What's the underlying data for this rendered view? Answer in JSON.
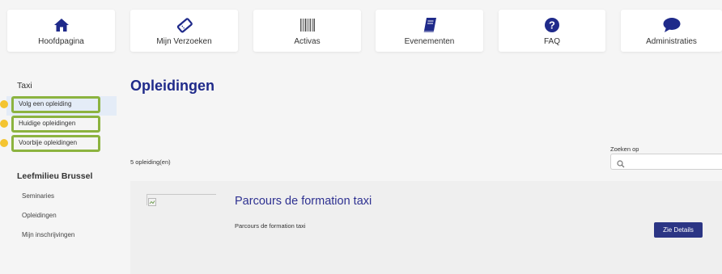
{
  "nav": {
    "items": [
      {
        "label": "Hoofdpagina",
        "icon": "home-icon"
      },
      {
        "label": "Mijn Verzoeken",
        "icon": "ticket-icon"
      },
      {
        "label": "Activas",
        "icon": "barcode-icon"
      },
      {
        "label": "Evenementen",
        "icon": "book-icon"
      },
      {
        "label": "FAQ",
        "icon": "question-circle-icon"
      },
      {
        "label": "Administraties",
        "icon": "speech-bubble-icon"
      }
    ],
    "accent_color": "#1f2a8a"
  },
  "sidebar": {
    "section1_title": "Taxi",
    "section1_items": [
      {
        "label": "Volg een opleiding"
      },
      {
        "label": "Huidige opleidingen"
      },
      {
        "label": "Voorbije opleidingen"
      }
    ],
    "section2_title": "Leefmilieu Brussel",
    "section2_items": [
      {
        "label": "Seminaries"
      },
      {
        "label": "Opleidingen"
      },
      {
        "label": "Mijn inschrijvingen"
      }
    ],
    "highlight_color": "#8cb33f"
  },
  "main": {
    "title": "Opleidingen",
    "count_text": "5 opleiding(en)",
    "search_label": "Zoeken op",
    "search_value": "",
    "course": {
      "title": "Parcours de formation taxi",
      "description": "Parcours de formation taxi",
      "button_label": "Zie Details"
    }
  }
}
